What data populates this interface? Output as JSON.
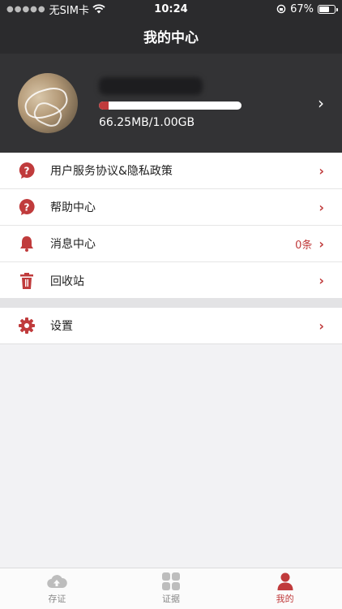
{
  "status": {
    "carrier": "无SIM卡",
    "time": "10:24",
    "battery": "67%",
    "battery_level": 0.67
  },
  "nav": {
    "title": "我的中心"
  },
  "profile": {
    "storage_text": "66.25MB/1.00GB",
    "storage_fraction": 0.066
  },
  "menu": {
    "items": [
      {
        "label": "用户服务协议&隐私政策",
        "icon": "question-icon"
      },
      {
        "label": "帮助中心",
        "icon": "question-icon"
      },
      {
        "label": "消息中心",
        "icon": "bell-icon",
        "badge": "0条"
      },
      {
        "label": "回收站",
        "icon": "trash-icon"
      }
    ],
    "settings": {
      "label": "设置",
      "icon": "gear-icon"
    }
  },
  "tabs": [
    {
      "label": "存证",
      "icon": "cloud-upload-icon"
    },
    {
      "label": "证据",
      "icon": "grid-icon"
    },
    {
      "label": "我的",
      "icon": "person-icon",
      "active": true
    }
  ],
  "colors": {
    "accent": "#c03b3c",
    "header": "#2b2b2d"
  }
}
